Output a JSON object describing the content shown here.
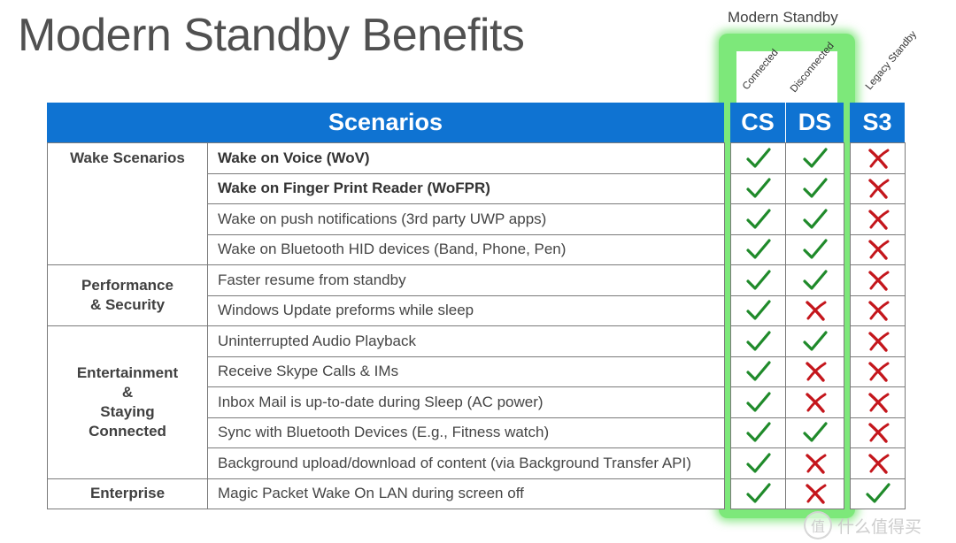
{
  "title": "Modern Standby Benefits",
  "modern_standby_label": "Modern Standby",
  "column_annotations": [
    "Connected",
    "Disconnected",
    "Legacy Standby"
  ],
  "header": {
    "scenarios": "Scenarios",
    "columns": [
      "CS",
      "DS",
      "S3"
    ]
  },
  "colors": {
    "header_blue": "#0f73d2",
    "highlight_green": "#7de87a",
    "check_green": "#1f8a2a",
    "cross_red": "#c4161c"
  },
  "categories": [
    {
      "label": "Wake Scenarios",
      "rows": 4
    },
    {
      "label": "Performance\n& Security",
      "rows": 2
    },
    {
      "label": "Entertainment\n&\nStaying\nConnected",
      "rows": 5
    },
    {
      "label": "Enterprise",
      "rows": 1
    }
  ],
  "rows": [
    {
      "scenario": "Wake on Voice (WoV)",
      "bold": true,
      "cs": "check",
      "ds": "check",
      "s3": "cross"
    },
    {
      "scenario": "Wake on Finger Print Reader (WoFPR)",
      "bold": true,
      "cs": "check",
      "ds": "check",
      "s3": "cross"
    },
    {
      "scenario": "Wake on push notifications (3rd party UWP apps)",
      "bold": false,
      "cs": "check",
      "ds": "check",
      "s3": "cross"
    },
    {
      "scenario": "Wake on Bluetooth HID devices (Band, Phone, Pen)",
      "bold": false,
      "cs": "check",
      "ds": "check",
      "s3": "cross"
    },
    {
      "scenario": "Faster resume from standby",
      "bold": false,
      "cs": "check",
      "ds": "check",
      "s3": "cross"
    },
    {
      "scenario": "Windows Update preforms while sleep",
      "bold": false,
      "cs": "check",
      "ds": "cross",
      "s3": "cross"
    },
    {
      "scenario": "Uninterrupted Audio Playback",
      "bold": false,
      "cs": "check",
      "ds": "check",
      "s3": "cross"
    },
    {
      "scenario": "Receive Skype Calls & IMs",
      "bold": false,
      "cs": "check",
      "ds": "cross",
      "s3": "cross"
    },
    {
      "scenario": "Inbox Mail is up-to-date during Sleep (AC power)",
      "bold": false,
      "cs": "check",
      "ds": "cross",
      "s3": "cross"
    },
    {
      "scenario": "Sync with Bluetooth Devices (E.g., Fitness watch)",
      "bold": false,
      "cs": "check",
      "ds": "check",
      "s3": "cross"
    },
    {
      "scenario": "Background upload/download of content (via Background Transfer API)",
      "bold": false,
      "cs": "check",
      "ds": "cross",
      "s3": "cross"
    },
    {
      "scenario": "Magic Packet Wake On LAN during screen off",
      "bold": false,
      "cs": "check",
      "ds": "cross",
      "s3": "check"
    }
  ],
  "watermark": {
    "badge": "值",
    "text": "什么值得买"
  }
}
